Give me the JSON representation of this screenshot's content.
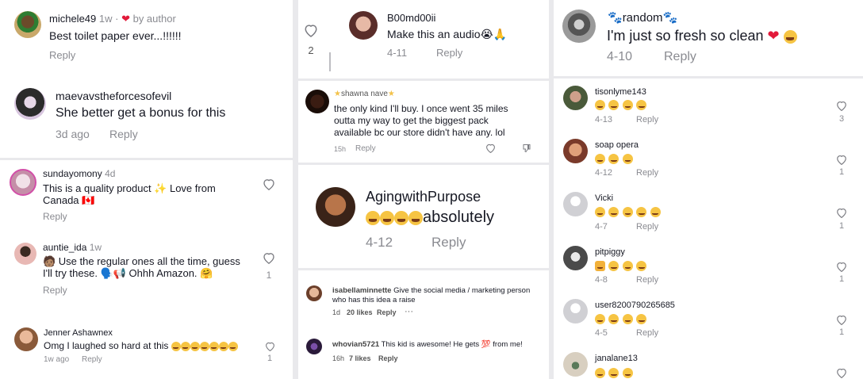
{
  "col1": {
    "c1": {
      "user": "michele49",
      "meta": "1w · ",
      "author": "by author",
      "text": "Best toilet paper ever...!!!!!!",
      "reply": "Reply"
    },
    "c2": {
      "user": "maevavstheforcesofevil",
      "text": "She better get a bonus for this",
      "time": "3d ago",
      "reply": "Reply"
    },
    "c3": {
      "user": "sundayomony",
      "time": "4d",
      "text1": "This is a quality product ✨ Love from",
      "text2": "Canada 🇨🇦",
      "reply": "Reply"
    },
    "c4": {
      "user": "auntie_ida",
      "time": "1w",
      "text1": "🧑🏽 Use the regular ones all the time, guess",
      "text2": "I'll try these. 🗣️📢 Ohhh Amazon. 🤗",
      "reply": "Reply",
      "likes": "1"
    },
    "c5": {
      "user": "Jenner Ashawnex",
      "text": "Omg I laughed so hard at this ",
      "time": "1w ago",
      "reply": "Reply",
      "likes": "1"
    }
  },
  "col2": {
    "c1": {
      "user": "B00md00ii",
      "text": "Make this an audio😭🙏",
      "time": "4-11",
      "reply": "Reply",
      "likes": "2"
    },
    "c2": {
      "user": "shawna nave",
      "text1": "the only kind I'll buy. I once went 35 miles",
      "text2": "outta my way to get the biggest pack",
      "text3": "available bc our store didn't have any. lol",
      "time": "15h",
      "reply": "Reply"
    },
    "c3": {
      "user": "AgingwithPurpose",
      "text": "absolutely",
      "time": "4-12",
      "reply": "Reply"
    },
    "c4": {
      "user": "isabellaminnette",
      "text1": "Give the social media / marketing person",
      "text2": "who has this idea a raise",
      "time": "1d",
      "likes": "20 likes",
      "reply": "Reply",
      "more": "···"
    },
    "c5": {
      "user": "whovian5721",
      "text": "This kid is awesome! He gets 💯 from me!",
      "time": "16h",
      "likes": "7 likes",
      "reply": "Reply"
    }
  },
  "col3": {
    "c1": {
      "user": "random",
      "text": "I'm just so fresh so clean ",
      "time": "4-10",
      "reply": "Reply"
    },
    "c2": {
      "user": "tisonlyme143",
      "time": "4-13",
      "reply": "Reply",
      "likes": "3"
    },
    "c3": {
      "user": "soap opera",
      "time": "4-12",
      "reply": "Reply",
      "likes": "1"
    },
    "c4": {
      "user": "Vicki",
      "time": "4-7",
      "reply": "Reply",
      "likes": "1"
    },
    "c5": {
      "user": "pitpiggy",
      "time": "4-8",
      "reply": "Reply",
      "likes": "1"
    },
    "c6": {
      "user": "user8200790265685",
      "time": "4-5",
      "reply": "Reply",
      "likes": "1"
    },
    "c7": {
      "user": "janalane13"
    }
  },
  "colors": {
    "heart_red": "#e21a3a",
    "muted": "#8a8b91",
    "text": "#161823"
  }
}
